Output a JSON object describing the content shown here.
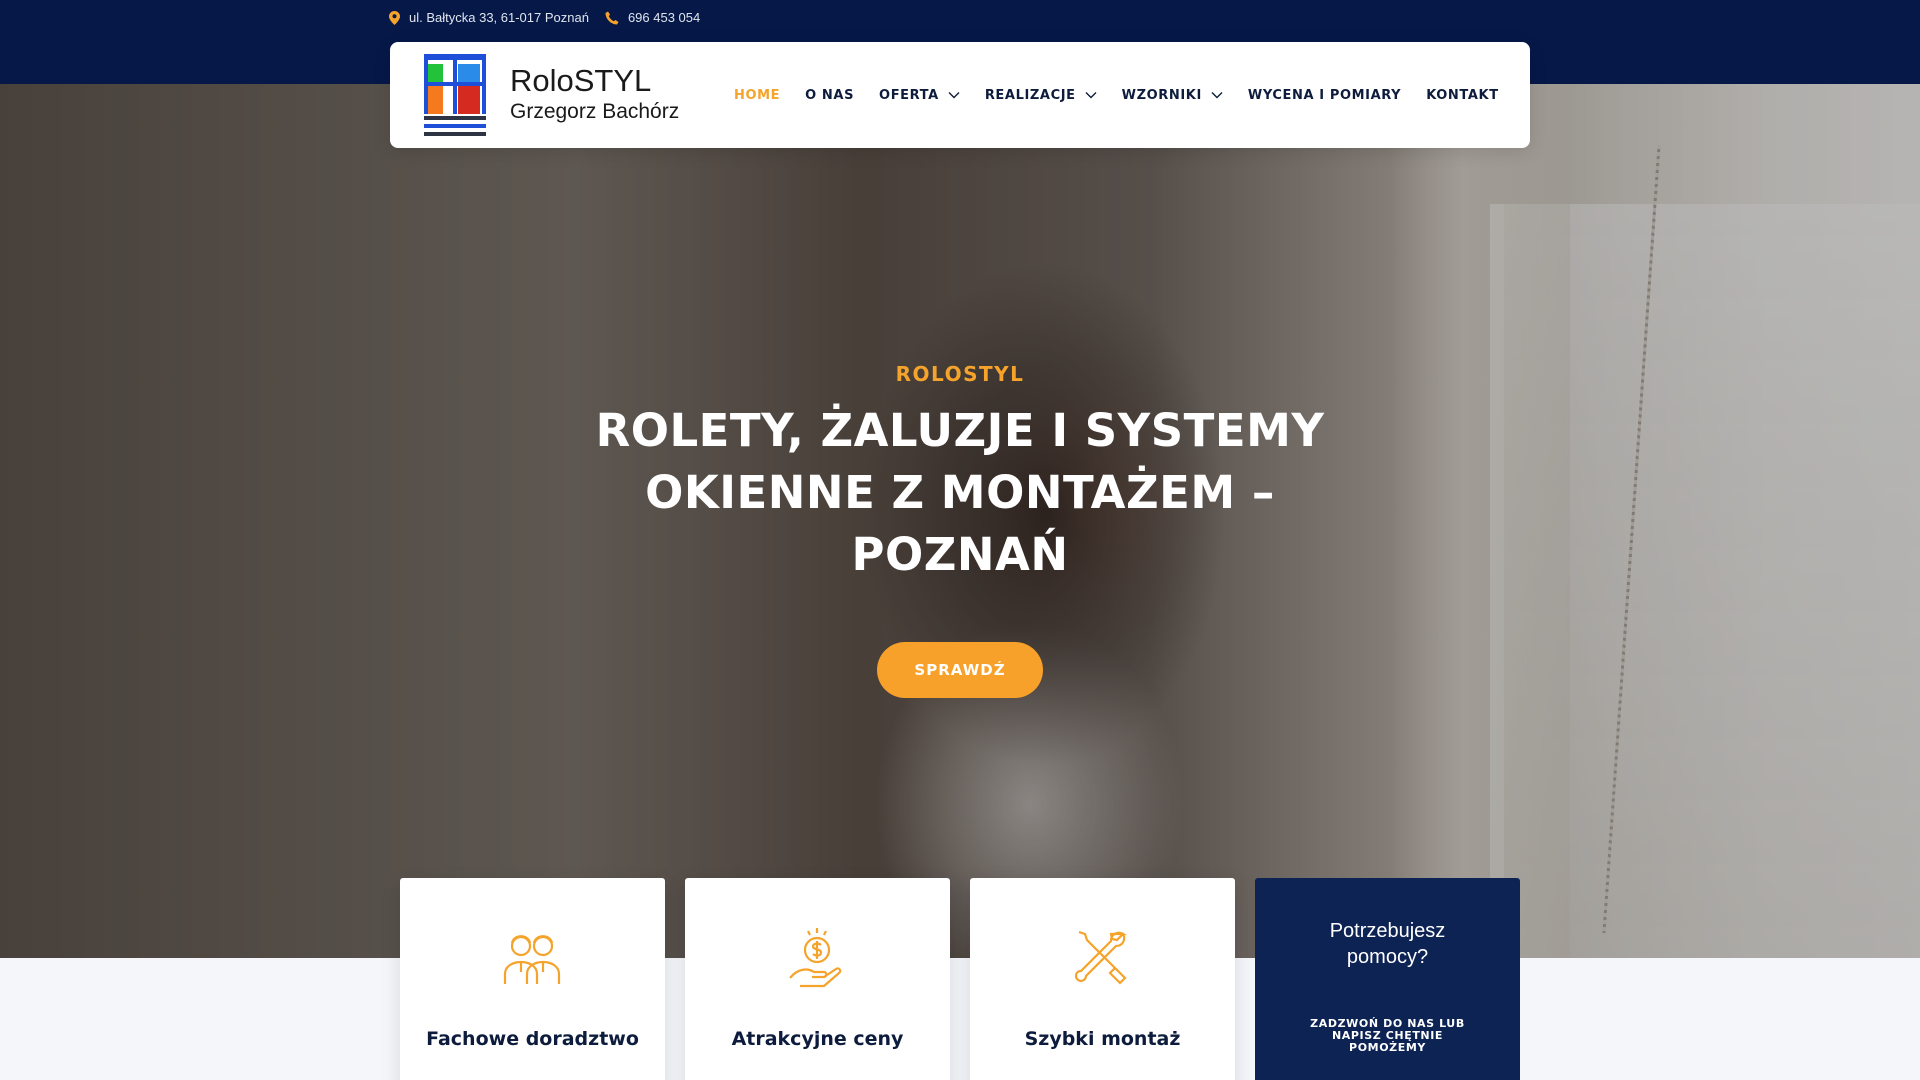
{
  "topbar": {
    "address": "ul. Bałtycka 33, 61-017 Poznań",
    "phone": "696 453 054",
    "address_icon": "map-pin-icon",
    "phone_icon": "phone-icon",
    "icon_color": "#f5a32b",
    "background": "#061848"
  },
  "header": {
    "logo_name": "RoloSTYL",
    "logo_sub": "Grzegorz Bachórz",
    "nav": [
      {
        "label": "HOME",
        "active": true,
        "dropdown": false
      },
      {
        "label": "O NAS",
        "active": false,
        "dropdown": false
      },
      {
        "label": "OFERTA",
        "active": false,
        "dropdown": true
      },
      {
        "label": "REALIZACJE",
        "active": false,
        "dropdown": true
      },
      {
        "label": "WZORNIKI",
        "active": false,
        "dropdown": true
      },
      {
        "label": "WYCENA I POMIARY",
        "active": false,
        "dropdown": false
      },
      {
        "label": "KONTAKT",
        "active": false,
        "dropdown": false
      }
    ]
  },
  "hero": {
    "eyebrow": "ROLOSTYL",
    "title_line1": "ROLETY, ŻALUZJE I SYSTEMY",
    "title_line2": "OKIENNE Z MONTAŻEM –",
    "title_line3": "POZNAŃ",
    "cta": "SPRAWDŹ",
    "accent": "#f7a12a"
  },
  "features": [
    {
      "title": "Fachowe doradztwo",
      "icon": "advisors-icon"
    },
    {
      "title": "Atrakcyjne ceny",
      "icon": "money-hand-icon"
    },
    {
      "title": "Szybki montaż",
      "icon": "tools-icon"
    }
  ],
  "help": {
    "title_line1": "Potrzebujesz",
    "title_line2": "pomocy?",
    "text_line1": "ZADZWOŃ DO NAS LUB",
    "text_line2": "NAPISZ CHĘTNIE",
    "text_line3": "POMOŻEMY",
    "background": "#0d2354"
  }
}
